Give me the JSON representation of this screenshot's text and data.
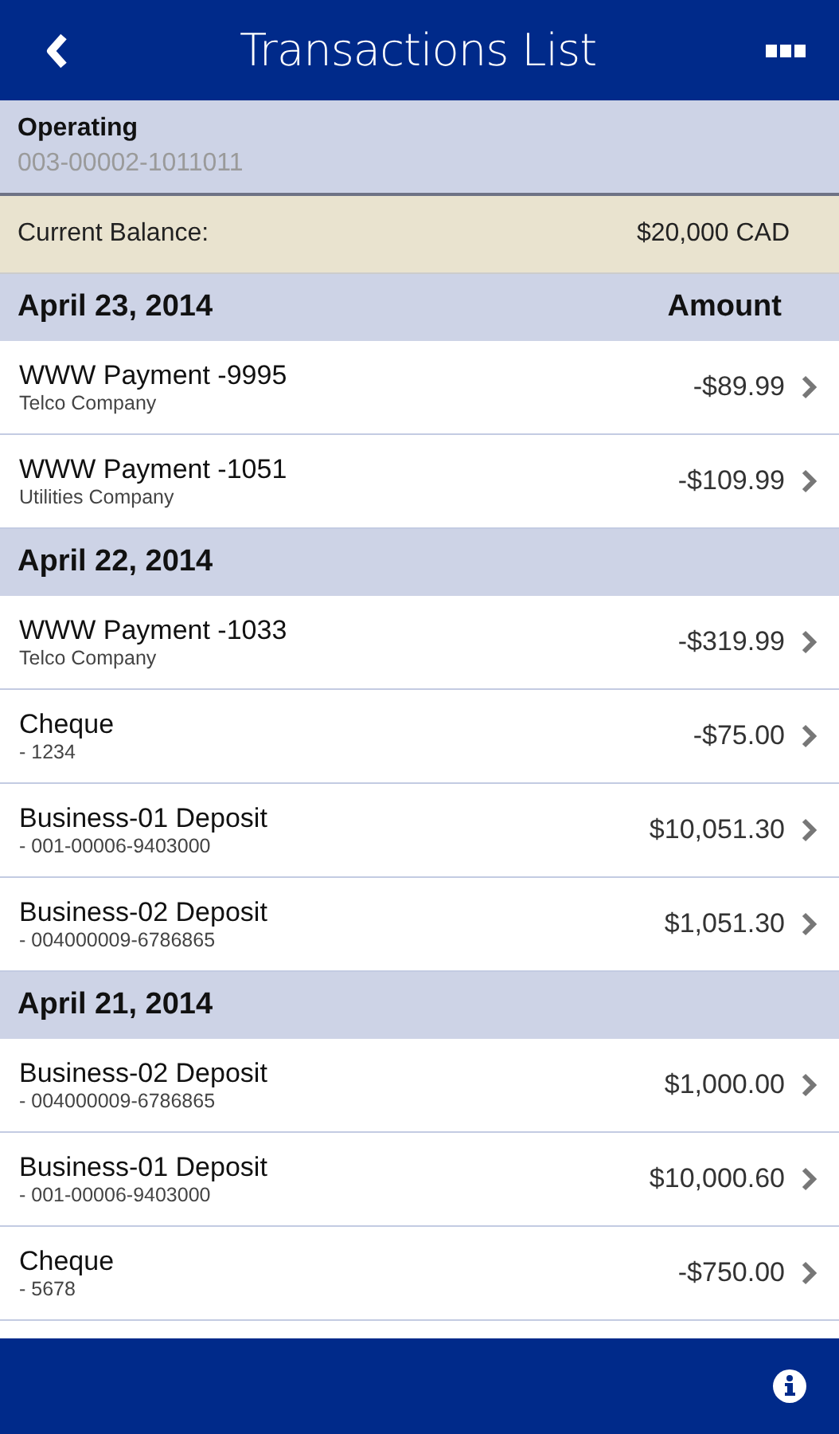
{
  "header": {
    "title": "Transactions List"
  },
  "account": {
    "name": "Operating",
    "number": "003-00002-1011011"
  },
  "balance": {
    "label": "Current Balance:",
    "value": "$20,000 CAD"
  },
  "sections": [
    {
      "date": "April 23, 2014",
      "column": "Amount",
      "rows": [
        {
          "title": "WWW Payment -9995",
          "subtitle": "Telco Company",
          "amount": "-$89.99"
        },
        {
          "title": "WWW Payment -1051",
          "subtitle": "Utilities Company",
          "amount": "-$109.99"
        }
      ]
    },
    {
      "date": "April 22, 2014",
      "rows": [
        {
          "title": "WWW Payment -1033",
          "subtitle": "Telco Company",
          "amount": "-$319.99"
        },
        {
          "title": "Cheque",
          "subtitle": "- 1234",
          "amount": "-$75.00"
        },
        {
          "title": "Business-01 Deposit",
          "subtitle": "- 001-00006-9403000",
          "amount": "$10,051.30"
        },
        {
          "title": "Business-02 Deposit",
          "subtitle": "- 004000009-6786865",
          "amount": "$1,051.30"
        }
      ]
    },
    {
      "date": "April 21, 2014",
      "rows": [
        {
          "title": "Business-02 Deposit",
          "subtitle": "- 004000009-6786865",
          "amount": "$1,000.00"
        },
        {
          "title": "Business-01 Deposit",
          "subtitle": "- 001-00006-9403000",
          "amount": "$10,000.60"
        },
        {
          "title": "Cheque",
          "subtitle": "- 5678",
          "amount": "-$750.00"
        }
      ]
    }
  ]
}
